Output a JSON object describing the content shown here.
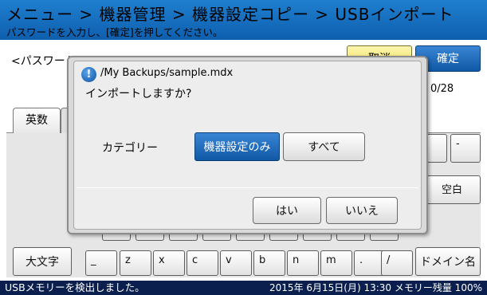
{
  "header": {
    "breadcrumb": "メニュー > 機器管理 > 機器設定コピー > USBインポート",
    "instruction": "パスワードを入力し、[確定]を押してください。"
  },
  "form": {
    "password_label": "<パスワード>",
    "cancel_label": "取消",
    "ok_label": "確定",
    "counter": "0/28",
    "tab_alpha": "英数"
  },
  "keyboard": {
    "top_keys": [
      "",
      "-"
    ],
    "space_label": "空白",
    "caps_label": "大文字",
    "bottom_keys": [
      "_",
      "z",
      "x",
      "c",
      "v",
      "b",
      "n",
      "m",
      ".",
      "/"
    ],
    "domain_label": "ドメイン名"
  },
  "dialog": {
    "icon": "info-icon",
    "icon_glyph": "!",
    "path": "/My Backups/sample.mdx",
    "question": "インポートしますか?",
    "category_label": "カテゴリー",
    "category_options": [
      "機器設定のみ",
      "すべて"
    ],
    "selected_category": "機器設定のみ",
    "yes_label": "はい",
    "no_label": "いいえ"
  },
  "status": {
    "message": "USBメモリーを検出しました。",
    "datetime": "2015年 6月15日(月) 13:30 メモリー残量 100%"
  },
  "colors": {
    "title_bar": "#0e5fae",
    "status_bar": "#0b1f4e",
    "selected": "#0f58a6",
    "cancel": "#e6d54a"
  }
}
